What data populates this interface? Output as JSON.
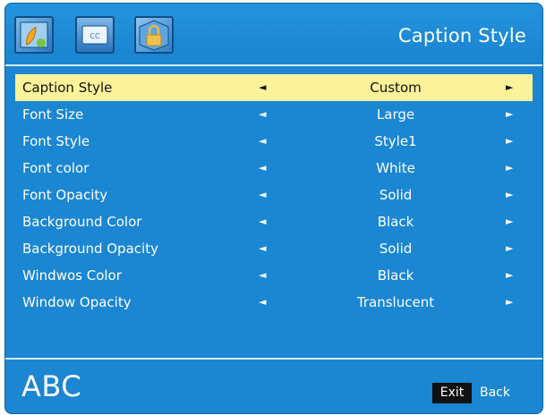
{
  "header": {
    "title": "Caption Style",
    "tabs": [
      {
        "icon": "picture-palette-icon"
      },
      {
        "icon": "closed-caption-icon"
      },
      {
        "icon": "lock-icon"
      }
    ]
  },
  "menu": {
    "rows": [
      {
        "label": "Caption Style",
        "value": "Custom",
        "selected": true
      },
      {
        "label": "Font Size",
        "value": "Large"
      },
      {
        "label": "Font Style",
        "value": "Style1"
      },
      {
        "label": "Font color",
        "value": "White"
      },
      {
        "label": "Font Opacity",
        "value": "Solid"
      },
      {
        "label": "Background Color",
        "value": "Black"
      },
      {
        "label": "Background Opacity",
        "value": "Solid"
      },
      {
        "label": "Windwos Color",
        "value": "Black"
      },
      {
        "label": "Window Opacity",
        "value": "Translucent"
      }
    ],
    "arrow_left": "◄",
    "arrow_right": "►"
  },
  "footer": {
    "preview_text": "ABC",
    "exit_key": "Exit",
    "back_label": "Back"
  },
  "colors": {
    "background": "#1b86d2",
    "highlight": "#fbf29a",
    "text": "#ffffff"
  }
}
